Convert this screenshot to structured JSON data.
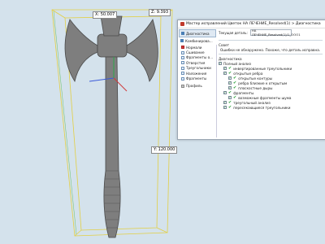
{
  "viewport": {
    "dims": {
      "x": "X: 50.007",
      "z": "Z: 9.393",
      "y": "Y: 120.000"
    },
    "colors": {
      "background": "#d4e2ec",
      "model": "#7e7e7e",
      "bbox": "#e7d34b"
    }
  },
  "dialog": {
    "title": "Мастер исправлений Цветок НА ЛЕЧЕНИЕ_Resolved(1) > Диагностика",
    "tabs": [
      "Диагностика",
      "Комбинирова..."
    ],
    "top_field": {
      "label": "Текущая деталь:",
      "value": "НА ЛЕЧЕНИЕ_Resolved(1)/1_OOO1"
    },
    "nav_items": [
      {
        "label": "Нормали",
        "icon": "red-square-icon"
      },
      {
        "label": "Сшивание",
        "icon": "square-icon"
      },
      {
        "label": "Фрагменты о...",
        "icon": "square-icon"
      },
      {
        "label": "Отверстия",
        "icon": "square-icon"
      },
      {
        "label": "Треугольники",
        "icon": "square-icon"
      },
      {
        "label": "Наложения",
        "icon": "square-icon"
      },
      {
        "label": "Фрагменты",
        "icon": "square-icon"
      },
      {
        "label": "Профиль",
        "icon": "gray-square-icon"
      }
    ],
    "advice_label": "Совет",
    "advice_text": "Ошибки не обнаружено. Похоже, что деталь исправна.",
    "diagnostics_label": "Диагностика",
    "full_analysis": "Полный анализ",
    "checks": [
      {
        "label": "инвертированные треугольники",
        "indent": 1
      },
      {
        "label": "открытые ребра",
        "indent": 1
      },
      {
        "label": "открытые контуры",
        "indent": 2
      },
      {
        "label": "ребра близкие к открытым",
        "indent": 2
      },
      {
        "label": "плоскостные дыры",
        "indent": 2
      },
      {
        "label": "фрагменты",
        "indent": 1
      },
      {
        "label": "возможные фрагменты шума",
        "indent": 2
      },
      {
        "label": "треугольный анализ",
        "indent": 1
      },
      {
        "label": "пересекающиеся треугольники",
        "indent": 1
      }
    ]
  }
}
